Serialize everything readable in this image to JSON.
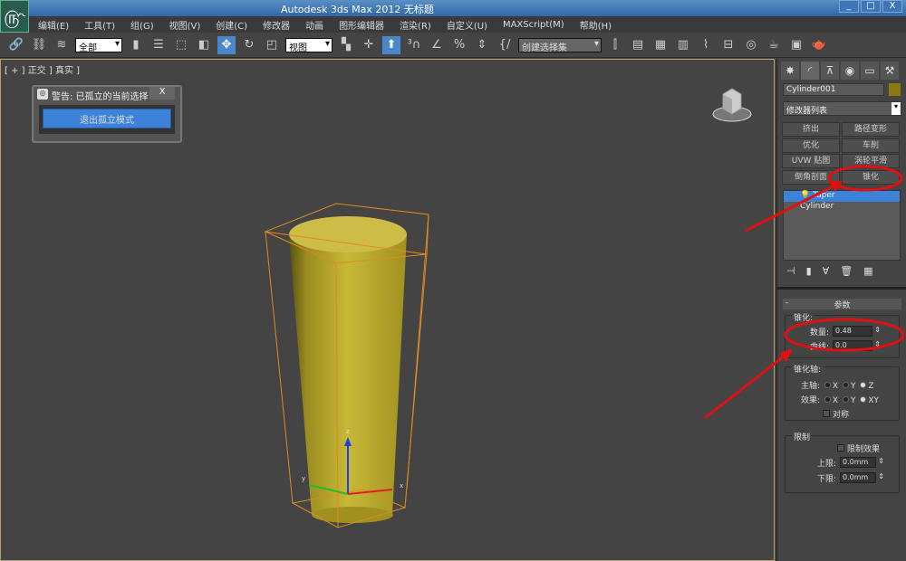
{
  "app": {
    "title": "Autodesk 3ds Max  2012      无标题",
    "logo_icon": "3dsmax-logo-icon",
    "window_buttons": [
      "_",
      "□",
      "X"
    ]
  },
  "menu": [
    "编辑(E)",
    "工具(T)",
    "组(G)",
    "视图(V)",
    "创建(C)",
    "修改器",
    "动画",
    "图形编辑器",
    "渲染(R)",
    "自定义(U)",
    "MAXScript(M)",
    "帮助(H)"
  ],
  "toolbar": {
    "filter": "全部",
    "coord": "视图",
    "selection_set": "创建选择集"
  },
  "viewport": {
    "label": "[ + ] 正交 ] 真实 ]",
    "axes": {
      "x": "x",
      "y": "y",
      "z": "z"
    }
  },
  "isolate_dialog": {
    "title": "警告: 已孤立的当前选择",
    "close": "X",
    "button": "退出孤立模式"
  },
  "panel": {
    "object_name": "Cylinder001",
    "object_color": "#8a7a10",
    "modifier_list": "修改器列表",
    "modifier_buttons": [
      "挤出",
      "路径变形",
      "优化",
      "车削",
      "UVW 贴图",
      "涡轮平滑",
      "倒角剖面",
      "锥化"
    ],
    "stack": [
      "Taper",
      "Cylinder"
    ],
    "rollout": "参数",
    "taper_group": "锥化:",
    "amount_label": "数量:",
    "amount": "0.48",
    "curve_label": "曲线:",
    "curve": "0.0",
    "axis_group": "锥化轴:",
    "primary_label": "主轴:",
    "effect_label": "效果:",
    "primary_options": [
      "X",
      "Y",
      "Z"
    ],
    "primary_selected": "Z",
    "effect_options": [
      "X",
      "Y",
      "XY"
    ],
    "effect_selected": "XY",
    "symmetry": "对称",
    "limits_group": "限制",
    "limit_effect": "限制效果",
    "upper_label": "上限:",
    "upper": "0.0mm",
    "lower_label": "下限:",
    "lower": "0.0mm"
  },
  "colors": {
    "accent": "#3c82d8",
    "annotation": "#e01010",
    "object": "#c8b838"
  }
}
